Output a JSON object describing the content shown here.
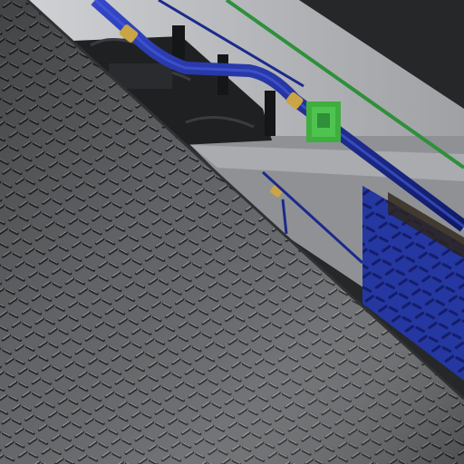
{
  "scene": {
    "description_visible_text": "",
    "colors": {
      "background_dark": "#262729",
      "wall_light": "#b9bbbf",
      "wall_mid": "#8e9094",
      "wall_shadow": "#4a4c50",
      "floor_plate_base": "#6b6d70",
      "floor_plate_light": "#9a9ca0",
      "floor_plate_dark": "#2b2c2e",
      "pipe_blue": "#1e2f9a",
      "pipe_blue_dark": "#101a63",
      "brass": "#c9a545",
      "green_cable": "#2f8f3a",
      "green_box": "#3fae3f",
      "blue_panel": "#2b3fb8"
    },
    "icons": [
      "pipe-fitting-icon",
      "junction-box-icon"
    ]
  }
}
